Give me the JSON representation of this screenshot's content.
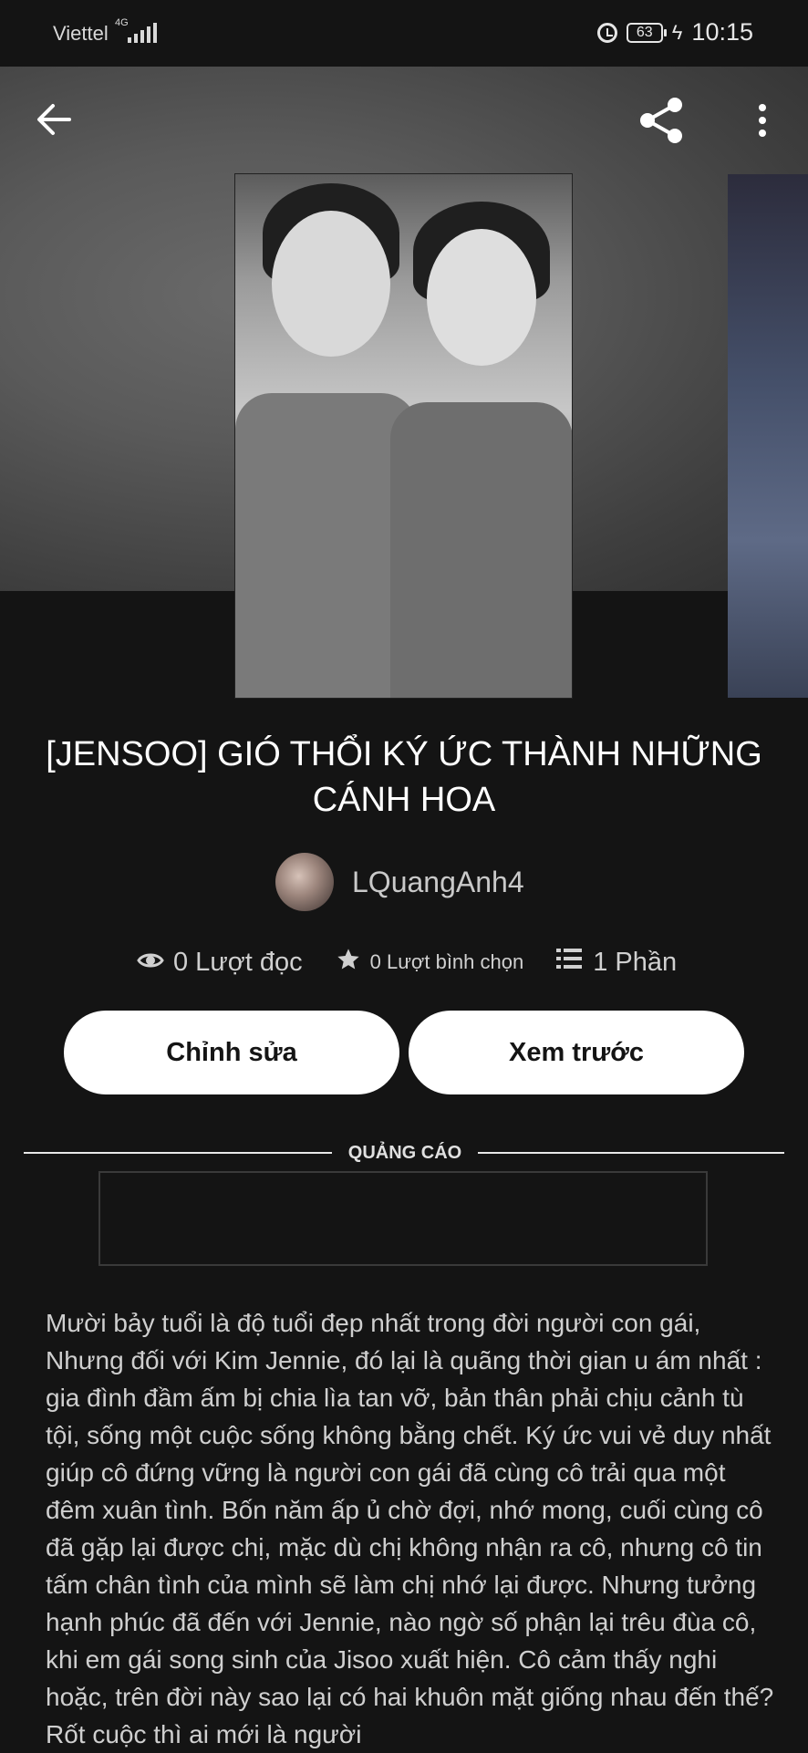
{
  "status_bar": {
    "carrier": "Viettel",
    "network": "4G",
    "battery": "63",
    "time": "10:15"
  },
  "story": {
    "title": "[JENSOO]  GIÓ THỔI KÝ ỨC THÀNH NHỮNG CÁNH HOA",
    "author": "LQuangAnh4",
    "reads": "0 Lượt đọc",
    "votes": "0 Lượt bình chọn",
    "parts": "1 Phần",
    "description": "Mười bảy tuổi là độ tuổi đẹp nhất trong đời người con gái, Nhưng đối với Kim Jennie, đó lại là quãng thời gian u ám nhất : gia đình đầm ấm bị chia lìa tan vỡ, bản thân phải chịu cảnh tù tội, sống một cuộc sống không bằng chết. Ký ức vui vẻ duy nhất giúp cô đứng vững là người con gái đã cùng cô trải qua một đêm xuân tình. Bốn năm ấp ủ chờ đợi, nhớ mong, cuối cùng cô đã gặp lại được chị, mặc dù chị không nhận ra cô, nhưng cô tin tấm chân tình của mình sẽ làm chị nhớ lại được. Nhưng tưởng hạnh phúc đã đến với Jennie, nào ngờ số phận lại trêu đùa cô, khi em gái song sinh của Jisoo xuất hiện. Cô cảm thấy nghi hoặc, trên đời này sao lại có hai khuôn mặt giống nhau đến thế? Rốt cuộc thì ai mới là người"
  },
  "actions": {
    "edit_label": "Chỉnh sửa",
    "preview_label": "Xem trước"
  },
  "ad": {
    "label": "QUẢNG CÁO"
  },
  "icons": [
    "back-arrow-icon",
    "share-icon",
    "more-vertical-icon",
    "eye-icon",
    "star-icon",
    "list-icon",
    "alarm-icon",
    "battery-icon",
    "charging-bolt-icon",
    "signal-icon"
  ]
}
